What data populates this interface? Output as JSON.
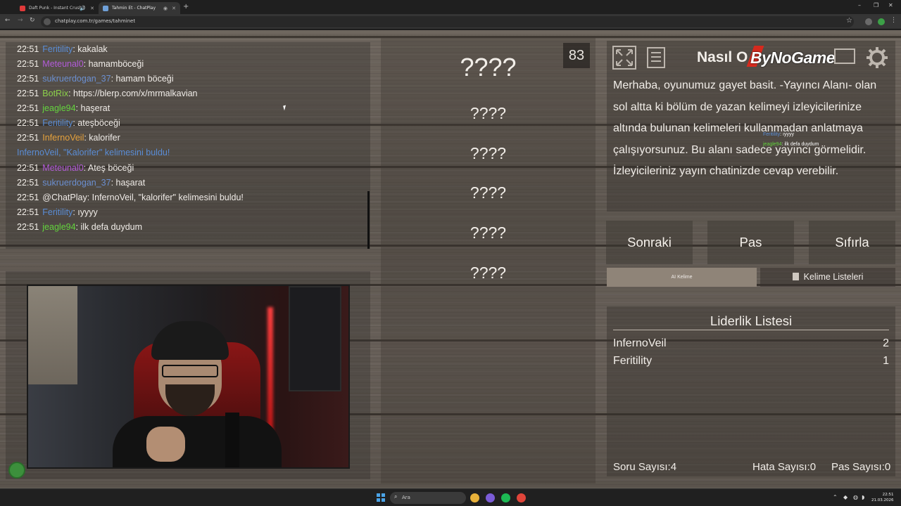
{
  "browser": {
    "tabs": [
      {
        "title": "Daft Punk - Instant Crush (",
        "active": false,
        "favicon_color": "#e03a3a"
      },
      {
        "title": "Tahmin Et - ChatPlay",
        "active": true,
        "favicon_color": "#6fa0d8"
      }
    ],
    "url": "chatplay.com.tr/games/tahminet",
    "window_controls": [
      "–",
      "❐",
      "✕"
    ]
  },
  "chat": {
    "messages": [
      {
        "time": "22:51",
        "user": "Feritility",
        "color": "#5a8dd6",
        "text": ": kakalak"
      },
      {
        "time": "22:51",
        "user": "Meteunal0",
        "color": "#b25bd8",
        "text": ": hamamböceği"
      },
      {
        "time": "22:51",
        "user": "sukruerdogan_37",
        "color": "#6b8fd0",
        "text": ": hamam böceği"
      },
      {
        "time": "22:51",
        "user": "BotRix",
        "color": "#8cd04a",
        "text": ": https://blerp.com/x/mrmalkavian"
      },
      {
        "time": "22:51",
        "user": "jeagle94",
        "color": "#63d43d",
        "text": ": haşerat"
      },
      {
        "time": "22:51",
        "user": "Feritility",
        "color": "#5a8dd6",
        "text": ": ateşböceği"
      },
      {
        "time": "22:51",
        "user": "InfernoVeil",
        "color": "#e6a23c",
        "text": ": kalorifer"
      },
      {
        "time": "",
        "user": "",
        "color": "#5a8dd6",
        "text": "InfernoVeil, \"Kalorifer\" kelimesini buldu!",
        "system": true
      },
      {
        "time": "22:51",
        "user": "Meteunal0",
        "color": "#b25bd8",
        "text": ": Ateş böceği"
      },
      {
        "time": "22:51",
        "user": "sukruerdogan_37",
        "color": "#6b8fd0",
        "text": ": haşarat"
      },
      {
        "time": "22:51",
        "user": "@ChatPlay",
        "color": "#f0ece8",
        "text": ": InfernoVeil, \"kalorifer\" kelimesini buldu!"
      },
      {
        "time": "22:51",
        "user": "Feritility",
        "color": "#5a8dd6",
        "text": ": ıyyyy"
      },
      {
        "time": "22:51",
        "user": "jeagle94",
        "color": "#63d43d",
        "text": ": ilk defa duydum"
      }
    ]
  },
  "words": {
    "timer": "83",
    "items": [
      "????",
      "????",
      "????",
      "????",
      "????",
      "????"
    ]
  },
  "howto": {
    "title": "Nasıl O",
    "brand": "ByNoGame",
    "text": "Merhaba, oyunumuz gayet basit. -Yayıncı Alanı- olan sol altta ki bölüm de yazan kelimeyi izleyicilerinize altında bulunan kelimeleri kullanmadan anlatmaya çalışıyorsunuz. Bu alanı sadece yayıncı görmelidir. İzleyicileriniz yayın chatinizde cevap verebilir.",
    "overlay": [
      {
        "user": "Feritility",
        "text": ": ıyyyy",
        "color": "#5a8dd6"
      },
      {
        "user": "jeagle94",
        "text": ": ilk defa duydum",
        "color": "#63d43d"
      }
    ],
    "icons": [
      "fullscreen-icon",
      "document-icon",
      "screen-icon",
      "gear-icon"
    ]
  },
  "controls": {
    "next": "Sonraki",
    "pass": "Pas",
    "reset": "Sıfırla",
    "ai_word": "AI Kelime",
    "word_lists": "Kelime Listeleri"
  },
  "leaderboard": {
    "title": "Liderlik Listesi",
    "rows": [
      {
        "name": "InfernoVeil",
        "score": "2"
      },
      {
        "name": "Feritility",
        "score": "1"
      }
    ],
    "question_count": "Soru Sayısı:4",
    "error_count": "Hata Sayısı:0",
    "pass_count": "Pas Sayısı:0"
  },
  "taskbar": {
    "search_placeholder": "Ara",
    "time": "22:51",
    "date": "21.03.2026"
  }
}
